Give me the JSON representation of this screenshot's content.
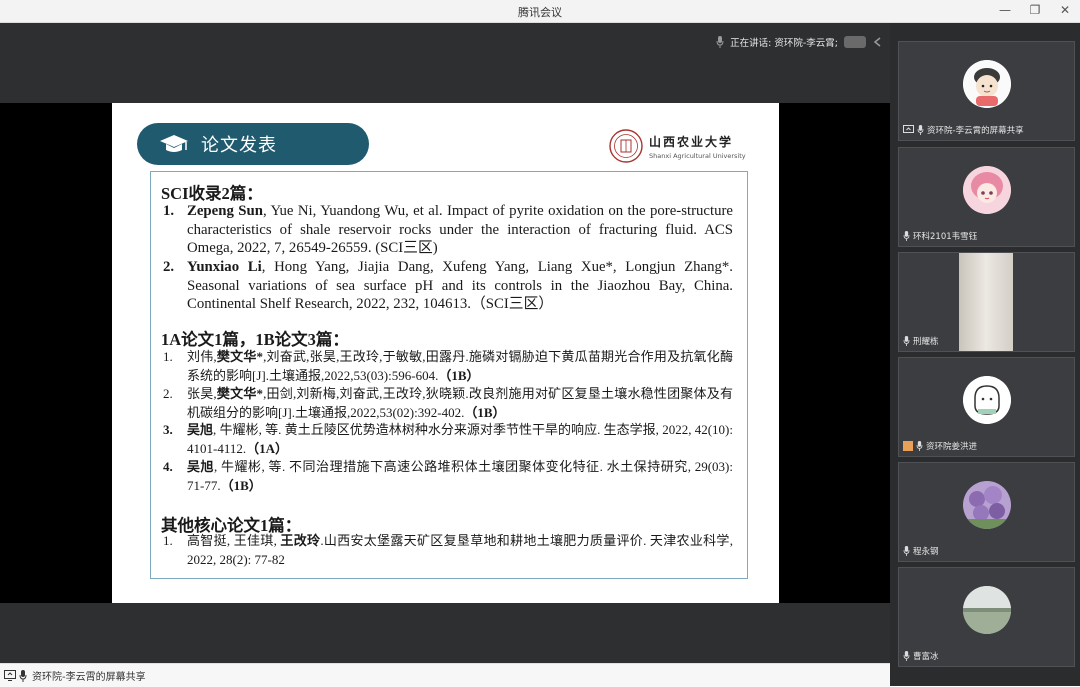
{
  "window": {
    "title": "腾讯会议"
  },
  "speaking": {
    "text": "正在讲话: 资环院-李云霄;"
  },
  "slide": {
    "title": "论文发表",
    "logo": {
      "name_cn": "山西农业大学",
      "name_en": "Shanxi Agricultural University"
    },
    "sci_section": {
      "heading": "SCI收录2篇：",
      "entries": [
        {
          "num": "1.",
          "author": "Zepeng Sun",
          "rest": ", Yue Ni, Yuandong Wu, et al. Impact of pyrite oxidation on the pore-structure characteristics of shale reservoir rocks under the interaction of fracturing fluid. ACS Omega, 2022, 7, 26549-26559. (SCI三区)"
        },
        {
          "num": "2.",
          "author": "Yunxiao Li",
          "rest": ", Hong Yang, Jiajia Dang, Xufeng Yang, Liang Xue*, Longjun Zhang*. Seasonal variations of sea surface pH and its controls in the Jiaozhou Bay, China. Continental Shelf Research, 2022, 232, 104613.（SCI三区）"
        }
      ]
    },
    "ab_section": {
      "heading": "1A论文1篇，1B论文3篇：",
      "entries": [
        {
          "num": "1.",
          "pre": "刘伟,",
          "bold": "樊文华*",
          "post": ",刘奋武,张昊,王改玲,于敏敏,田露丹.施磷对镉胁迫下黄瓜苗期光合作用及抗氧化酶系统的影响[J].土壤通报,2022,53(03):596-604.",
          "tag": "（1B）"
        },
        {
          "num": "2.",
          "pre": "张昊,",
          "bold": "樊文华*",
          "post": ",田剑,刘新梅,刘奋武,王改玲,狄晓颖.改良剂施用对矿区复垦土壤水稳性团聚体及有机碳组分的影响[J].土壤通报,2022,53(02):392-402.",
          "tag": "（1B）"
        },
        {
          "num": "3.",
          "pre": "",
          "bold": "吴旭",
          "post": ", 牛耀彬, 等. 黄土丘陵区优势造林树种水分来源对季节性干旱的响应. 生态学报, 2022, 42(10): 4101-4112.",
          "tag": "（1A）"
        },
        {
          "num": "4.",
          "pre": "",
          "bold": "吴旭",
          "post": ", 牛耀彬, 等. 不同治理措施下高速公路堆积体土壤团聚体变化特征. 水土保持研究, 29(03): 71-77.",
          "tag": "（1B）"
        }
      ]
    },
    "core_section": {
      "heading": "其他核心论文1篇：",
      "entries": [
        {
          "num": "1.",
          "pre": "高智挺, 王佳琪, ",
          "bold": "王改玲",
          "post": ".山西安太堡露天矿区复垦草地和耕地土壤肥力质量评价. 天津农业科学, 2022, 28(2): 77-82",
          "tag": ""
        }
      ]
    }
  },
  "bottom_bar": {
    "label": "资环院-李云霄的屏幕共享"
  },
  "participants": [
    {
      "name": "资环院-李云霄的屏幕共享",
      "icon": "screen-share-icon"
    },
    {
      "name": "环科2101韦雪钰",
      "icon": "mic-icon"
    },
    {
      "name": "刑耀栋",
      "icon": "mic-icon"
    },
    {
      "name": "资环院姜洪进",
      "icon": "mic-icon"
    },
    {
      "name": "程永钢",
      "icon": "mic-icon"
    },
    {
      "name": "曹富冰",
      "icon": "mic-icon"
    }
  ],
  "colors": {
    "header_teal": "#1f5a6e",
    "box_border": "#7fa9c0",
    "meeting_bg": "#2e2f31",
    "sidebar_bg": "#2b2c2e"
  }
}
